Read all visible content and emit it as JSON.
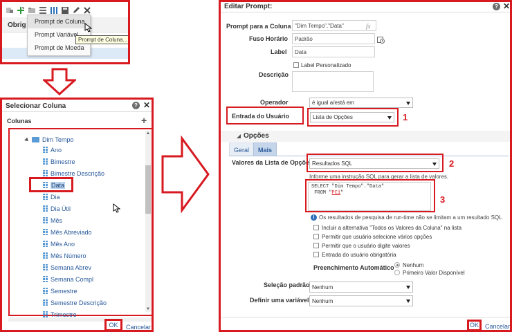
{
  "panel1": {
    "header_label": "Obrig",
    "toolbar_icons": [
      "add-filter-icon",
      "add-prompt-icon",
      "folder-icon",
      "rows-icon",
      "columns-icon",
      "save-icon",
      "edit-icon",
      "delete-icon"
    ],
    "menu": {
      "items": [
        "Prompt de Coluna",
        "Prompt Variável",
        "Prompt de Moeda"
      ],
      "highlighted": "Prompt de Coluna"
    },
    "tooltip": "Prompt de Coluna..."
  },
  "panel2": {
    "title": "Selecionar Coluna",
    "help_label": "?",
    "close_label": "✕",
    "colunas_label": "Colunas",
    "add_label": "+",
    "tree": {
      "root": "Dim Tempo",
      "items": [
        "Ano",
        "Bimestre",
        "Bimestre Descrição",
        "Data",
        "Dia",
        "Dia Útil",
        "Mês",
        "Mês Abreviado",
        "Mês Ano",
        "Mês Número",
        "Semana Abrev",
        "Semana Compl",
        "Semestre",
        "Semestre Descrição",
        "Trimestre"
      ],
      "selected": "Data"
    },
    "ok_label": "OK",
    "cancel_label": "Cancelar"
  },
  "panel3": {
    "title": "Editar Prompt:",
    "help_label": "?",
    "close_label": "✕",
    "fields": {
      "prompt_coluna_label": "Prompt para a Coluna",
      "prompt_coluna_value": "\"Dim Tempo\".\"Data\"",
      "fx_label": "fx",
      "fuso_label": "Fuso Horário",
      "fuso_value": "Padrão",
      "label_label": "Label",
      "label_value": "Data",
      "label_personalizado": "Label Personalizado",
      "descricao_label": "Descrição",
      "operador_label": "Operador",
      "operador_value": "é igual a/está em",
      "entrada_label": "Entrada do Usuário",
      "entrada_value": "Lista de Opções"
    },
    "opcoes": {
      "header": "Opções",
      "tabs": [
        "Geral",
        "Mais"
      ],
      "active_tab": "Mais",
      "valores_label": "Valores da Lista de Opções",
      "valores_value": "Resultados SQL",
      "sql_hint": "Informe uma instrução SQL para gerar a lista de valores.",
      "sql_line1": "SELECT \"Dim Tempo\".\"Data\"",
      "sql_line2_prefix": "FROM \"",
      "sql_line2_link": "PC1",
      "sql_line2_suffix": "\"",
      "info_text": "Os resultados de pesquisa de run-time não se limitam a um resultado SQL",
      "checkboxes": [
        "Incluir a alternativa \"Todos os Valores da Coluna\" na lista",
        "Permitir que usuário selecione vários opções",
        "Permitir que o usuário digite valores",
        "Entrada do usuário obrigatória"
      ],
      "preenchimento_label": "Preenchimento Automático",
      "preenchimento_options": [
        "Nenhum",
        "Primeiro Valor Disponível"
      ],
      "preenchimento_selected": "Nenhum",
      "selecao_label": "Seleção padrão",
      "selecao_value": "Nenhum",
      "definir_label": "Definir uma variável",
      "definir_value": "Nenhum"
    },
    "step_numbers": [
      "1",
      "2",
      "3"
    ],
    "ok_label": "OK",
    "cancel_label": "Cancelar"
  },
  "colors": {
    "annotation_red": "#d71920",
    "link_blue": "#2a5a9b",
    "selection_blue": "#b9d3ee",
    "icon_blue": "#5b9bd5"
  }
}
